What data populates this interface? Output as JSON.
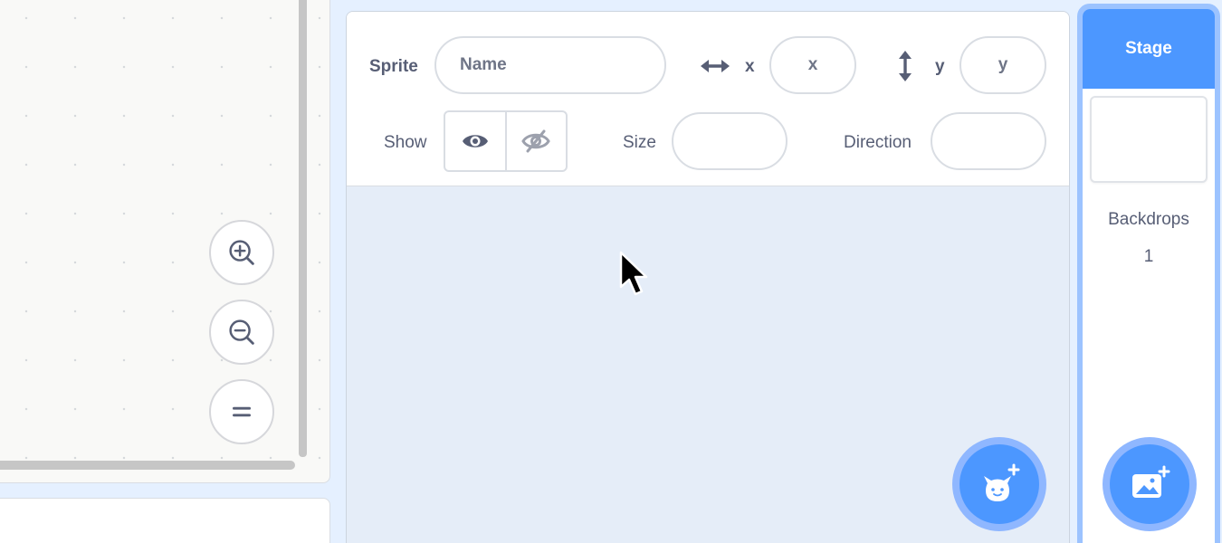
{
  "sprite_info": {
    "sprite_label": "Sprite",
    "name_placeholder": "Name",
    "x_label": "x",
    "x_placeholder": "x",
    "y_label": "y",
    "y_placeholder": "y",
    "show_label": "Show",
    "size_label": "Size",
    "size_value": "",
    "direction_label": "Direction",
    "direction_value": ""
  },
  "stage": {
    "title": "Stage",
    "backdrops_label": "Backdrops",
    "backdrops_count": "1"
  },
  "icons": {
    "zoom_in": "zoom-in-icon",
    "zoom_out": "zoom-out-icon",
    "zoom_reset": "equals-icon",
    "show_visible": "eye-icon",
    "show_hidden": "eye-slash-icon",
    "x_arrow": "horizontal-arrows-icon",
    "y_arrow": "vertical-arrows-icon",
    "add_sprite": "cat-plus-icon",
    "add_backdrop": "image-plus-icon"
  },
  "colors": {
    "accent": "#4c97ff",
    "accent_ring": "#8fb7ff",
    "text": "#575e75",
    "background": "#e5f0ff"
  }
}
